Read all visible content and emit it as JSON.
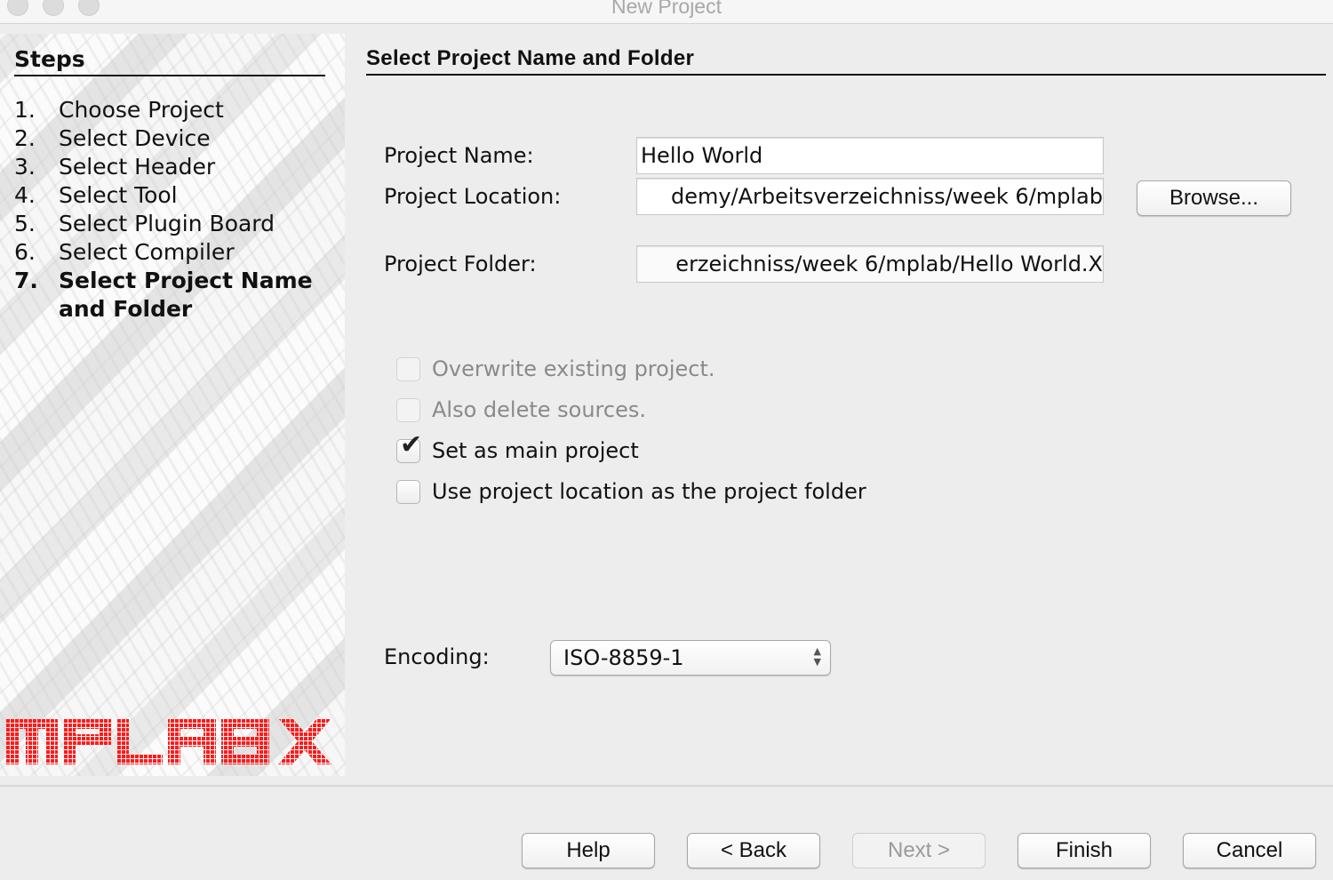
{
  "window": {
    "title": "New Project"
  },
  "sidebar": {
    "title": "Steps",
    "steps": [
      {
        "num": "1.",
        "label": "Choose Project",
        "active": false
      },
      {
        "num": "2.",
        "label": "Select Device",
        "active": false
      },
      {
        "num": "3.",
        "label": "Select Header",
        "active": false
      },
      {
        "num": "4.",
        "label": "Select Tool",
        "active": false
      },
      {
        "num": "5.",
        "label": "Select Plugin Board",
        "active": false
      },
      {
        "num": "6.",
        "label": "Select Compiler",
        "active": false
      },
      {
        "num": "7.",
        "label": "Select Project Name",
        "label2": "and Folder",
        "active": true
      }
    ],
    "logo_text": "MPLAB X",
    "logo_color": "#ff1a1a"
  },
  "main": {
    "title": "Select Project Name and Folder",
    "project_name": {
      "label": "Project Name:",
      "value": "Hello World"
    },
    "project_location": {
      "label": "Project Location:",
      "value": "demy/Arbeitsverzeichniss/week 6/mplab"
    },
    "project_folder": {
      "label": "Project Folder:",
      "value": "erzeichniss/week 6/mplab/Hello World.X"
    },
    "browse_label": "Browse...",
    "checkboxes": [
      {
        "label": "Overwrite existing project.",
        "checked": false,
        "enabled": false
      },
      {
        "label": "Also delete sources.",
        "checked": false,
        "enabled": false
      },
      {
        "label": "Set as main project",
        "checked": true,
        "enabled": true
      },
      {
        "label": "Use project location as the project folder",
        "checked": false,
        "enabled": true
      }
    ],
    "encoding": {
      "label": "Encoding:",
      "value": "ISO-8859-1"
    }
  },
  "footer": {
    "help": "Help",
    "back": "< Back",
    "next": "Next >",
    "finish": "Finish",
    "cancel": "Cancel"
  },
  "icons": {
    "checkmark": "✔",
    "select_arrows_up": "▲",
    "select_arrows_down": "▼"
  }
}
